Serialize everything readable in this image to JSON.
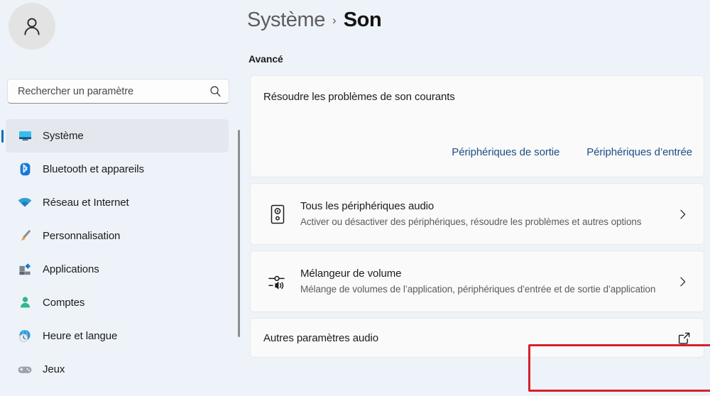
{
  "theme": {
    "page_bg": "#eef3f9",
    "card_bg": "#fafafa",
    "accent": "#0f6cbd",
    "link": "#1d4e84",
    "highlight": "#d6212a"
  },
  "sidebar": {
    "avatar": {
      "icon": "person-avatar-icon"
    },
    "search": {
      "placeholder": "Rechercher un paramètre",
      "value": "",
      "icon": "search-icon"
    },
    "items": [
      {
        "label": "Système",
        "icon": "monitor-icon",
        "selected": true
      },
      {
        "label": "Bluetooth et appareils",
        "icon": "bluetooth-icon",
        "selected": false
      },
      {
        "label": "Réseau et Internet",
        "icon": "wifi-icon",
        "selected": false
      },
      {
        "label": "Personnalisation",
        "icon": "paintbrush-icon",
        "selected": false
      },
      {
        "label": "Applications",
        "icon": "apps-icon",
        "selected": false
      },
      {
        "label": "Comptes",
        "icon": "person-icon",
        "selected": false
      },
      {
        "label": "Heure et langue",
        "icon": "clock-globe-icon",
        "selected": false
      },
      {
        "label": "Jeux",
        "icon": "gamepad-icon",
        "selected": false
      }
    ]
  },
  "header": {
    "breadcrumb_parent": "Système",
    "breadcrumb_separator": "›",
    "breadcrumb_current": "Son"
  },
  "main": {
    "section_title": "Avancé",
    "troubleshoot": {
      "title": "Résoudre les problèmes de son courants",
      "link_output": "Périphériques de sortie",
      "link_input": "Périphériques d’entrée"
    },
    "all_devices": {
      "title": "Tous les périphériques audio",
      "subtitle": "Activer ou désactiver des périphériques, résoudre les problèmes et autres options",
      "icon": "speaker-icon",
      "chevron": "chevron-right-icon"
    },
    "volume_mixer": {
      "title": "Mélangeur de volume",
      "subtitle": "Mélange de volumes de l’application, périphériques d’entrée et de sortie d’application",
      "icon": "volume-mixer-icon",
      "chevron": "chevron-right-icon"
    },
    "other_audio": {
      "title": "Autres paramètres audio",
      "icon": "external-link-icon",
      "highlighted": true
    }
  }
}
